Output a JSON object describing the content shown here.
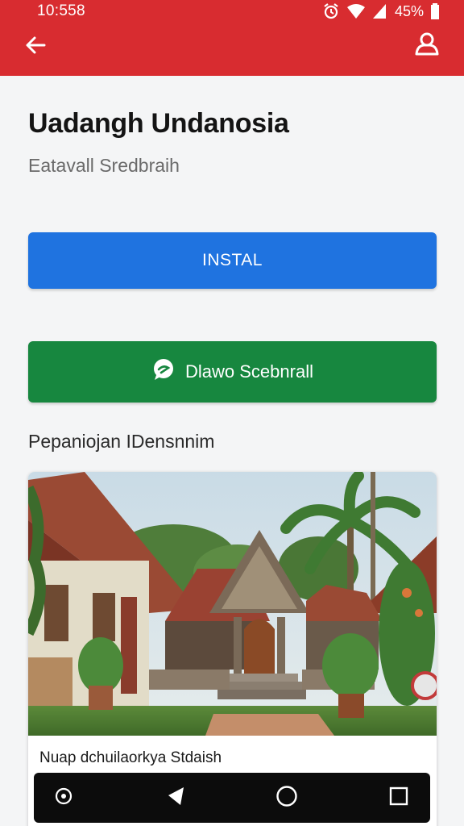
{
  "status_bar": {
    "time": "10:558",
    "battery": "45%"
  },
  "app_bar": {
    "back_icon": "arrow-left-icon",
    "account_icon": "user-icon"
  },
  "app": {
    "title": "Uadangh Undanosia",
    "subtitle": "Eatavall Sredbraih"
  },
  "buttons": {
    "install_label": "INSTAL",
    "secondary_label": "Dlawo Scebnrall",
    "secondary_icon": "chat-bubble-icon"
  },
  "section": {
    "label": "Pepaniojan IDensnnim"
  },
  "card": {
    "caption": "Nuap dchuilaorkya Stdaish"
  },
  "nav_bar": {
    "items": [
      "settings-dot-icon",
      "back-triangle-icon",
      "home-circle-icon",
      "recents-square-icon"
    ]
  },
  "colors": {
    "app_bar": "#d82c30",
    "install_button": "#1f73e0",
    "secondary_button": "#17873f",
    "nav_bar": "#0c0c0c"
  }
}
